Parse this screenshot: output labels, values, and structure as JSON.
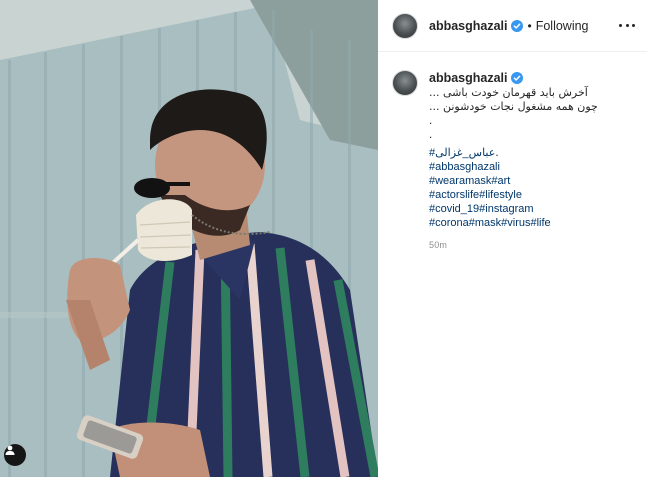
{
  "post": {
    "username": "abbasghazali",
    "separator": "•",
    "follow_label": "Following",
    "photo_alt": "Man lowering a face mask, holding a phone",
    "caption_lines": [
      "آخرش باید قهرمان خودت باشی ...",
      "چون همه مشغول نجات خودشونن ...",
      ".",
      "."
    ],
    "hashtags": [
      "#عباس_غزالی",
      "#abbasghazali",
      "#wearamask#art",
      "#actorslife#lifestyle",
      "#covid_19#instagram",
      "#corona#mask#virus#life"
    ],
    "hashtag_first_suffix": " .",
    "timestamp": "50m"
  },
  "colors": {
    "link": "#00376b",
    "verified": "#3897f0",
    "meta": "#8e8e8e",
    "text": "#262626"
  },
  "icons": {
    "verified": "verified-badge-icon",
    "more": "more-options-icon",
    "tag": "user-tag-icon"
  }
}
